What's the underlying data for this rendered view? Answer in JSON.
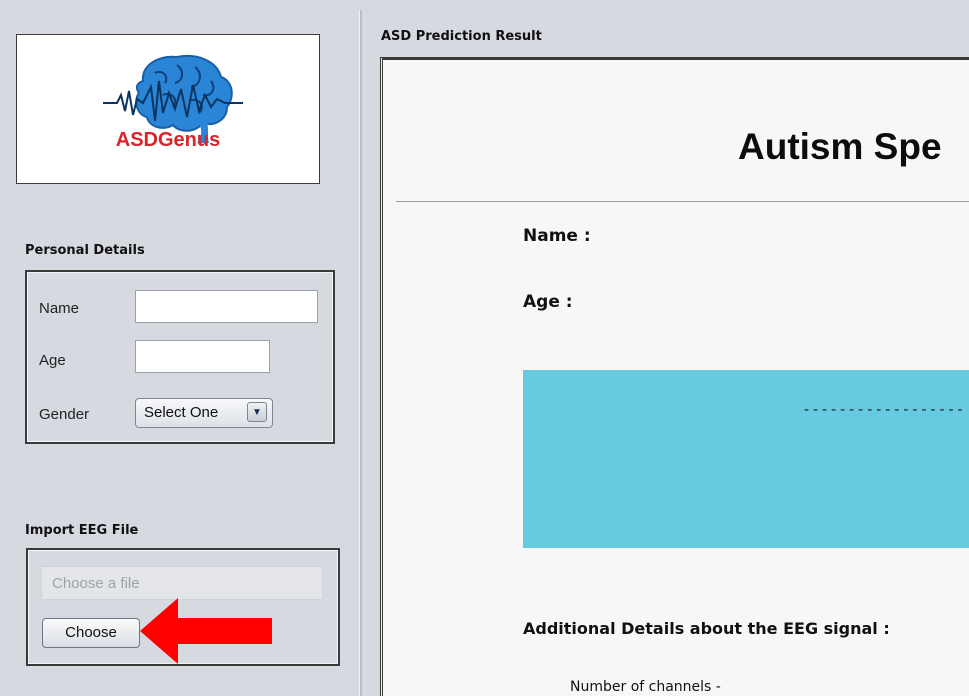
{
  "logo": {
    "text": "ASDGenus",
    "text_color": "#d6262b",
    "brain_color": "#1f78c4"
  },
  "personal_details": {
    "title": "Personal Details",
    "name_label": "Name",
    "name_value": "",
    "age_label": "Age",
    "age_value": "",
    "gender_label": "Gender",
    "gender_selected": "Select One"
  },
  "import_eeg": {
    "title": "Import EEG File",
    "placeholder": "Choose a file",
    "choose_label": "Choose"
  },
  "annotation": {
    "arrow_color": "#ff0000",
    "icon": "left-arrow-icon"
  },
  "result": {
    "panel_title": "ASD Prediction Result",
    "heading": "Autism Spe",
    "name_label": "Name :",
    "age_label": "Age :",
    "banner_color": "#66cbe0",
    "banner_text": "------------------",
    "additional_title": "Additional Details about the EEG signal :",
    "channels_label": "Number of channels -"
  }
}
